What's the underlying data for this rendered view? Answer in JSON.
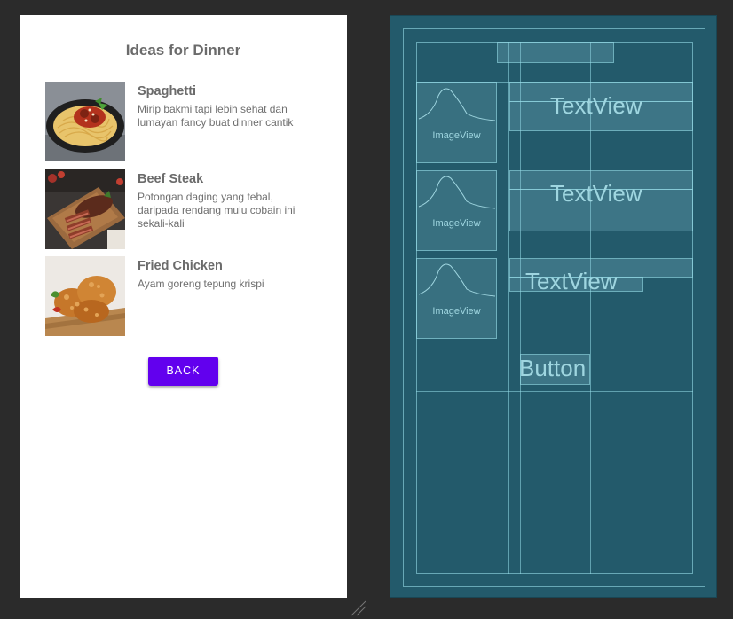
{
  "screen": {
    "title": "Ideas for Dinner",
    "items": [
      {
        "name": "Spaghetti",
        "description": "Mirip bakmi tapi lebih sehat dan lumayan fancy buat dinner cantik",
        "image_icon": "spaghetti-plate"
      },
      {
        "name": "Beef Steak",
        "description": "Potongan daging yang tebal, daripada rendang mulu cobain ini sekali-kali",
        "image_icon": "beef-steak-board"
      },
      {
        "name": "Fried Chicken",
        "description": "Ayam goreng tepung krispi",
        "image_icon": "fried-chicken"
      }
    ],
    "back_label": "BACK",
    "button_color": "#6200ee"
  },
  "blueprint": {
    "image_label": "ImageView",
    "text_label": "TextView",
    "button_label": "Button",
    "background_color": "#235a6b"
  }
}
